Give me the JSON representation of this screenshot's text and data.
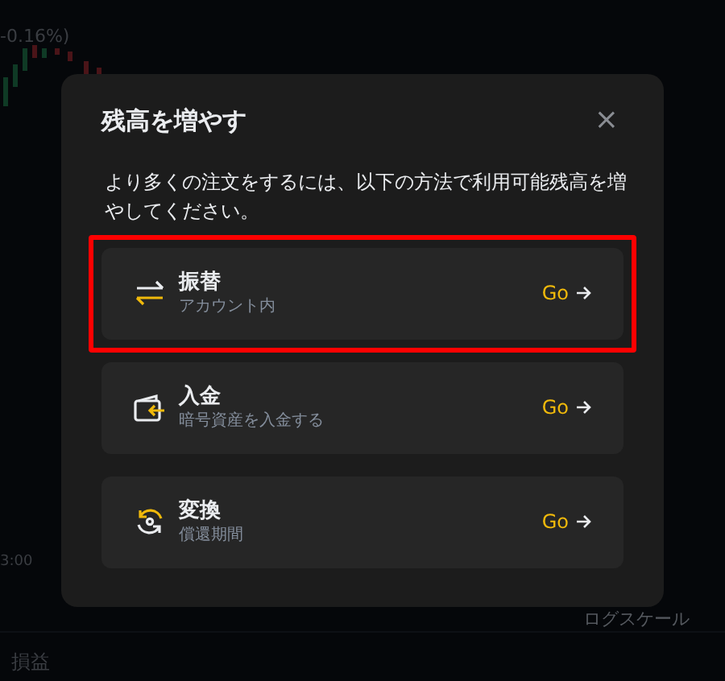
{
  "background": {
    "change": "-0.16%)",
    "time": "3:00",
    "scale": "ログスケール",
    "tab": "損益"
  },
  "dialog": {
    "title": "残高を増やす",
    "close": "×",
    "description": "より多くの注文をするには、以下の方法で利用可能残高を増やしてください。",
    "options": [
      {
        "kind": "transfer",
        "title": "振替",
        "subtitle": "アカウント内",
        "action": "Go",
        "highlighted": true
      },
      {
        "kind": "deposit",
        "title": "入金",
        "subtitle": "暗号資産を入金する",
        "action": "Go",
        "highlighted": false
      },
      {
        "kind": "convert",
        "title": "変換",
        "subtitle": "償還期間",
        "action": "Go",
        "highlighted": false
      }
    ]
  }
}
